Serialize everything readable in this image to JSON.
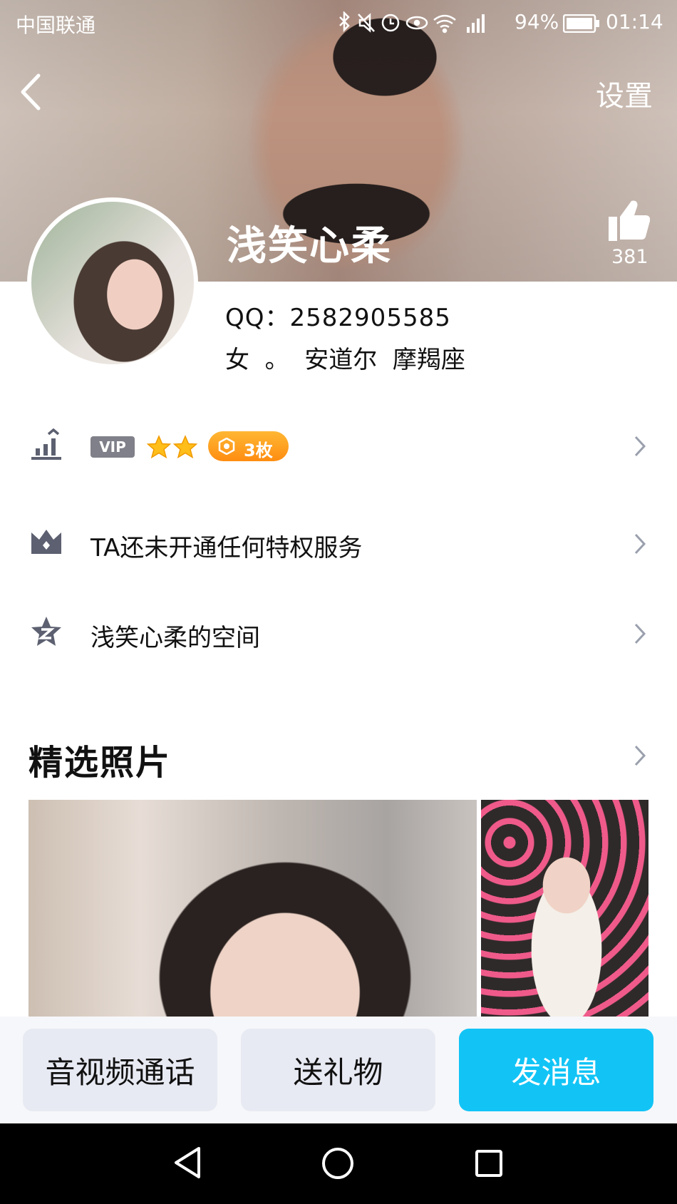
{
  "status_bar": {
    "carrier": "中国联通",
    "battery": "94%",
    "time": "01:14"
  },
  "header": {
    "settings_label": "设置",
    "like_count": "381"
  },
  "profile": {
    "nickname": "浅笑心柔",
    "qq": "QQ：2582905585",
    "info": "女  。  安道尔  摩羯座"
  },
  "rows": {
    "vip": {
      "badge": "VIP",
      "stars": 2,
      "coin_text": "3枚"
    },
    "privilege": {
      "label": "TA还未开通任何特权服务"
    },
    "space": {
      "label": "浅笑心柔的空间"
    }
  },
  "photos": {
    "title": "精选照片"
  },
  "actions": {
    "call": "音视频通话",
    "gift": "送礼物",
    "message": "发消息"
  },
  "colors": {
    "accent": "#12c4f6",
    "button_bg": "#e8eaf3",
    "coin": "#ff9f1f"
  }
}
